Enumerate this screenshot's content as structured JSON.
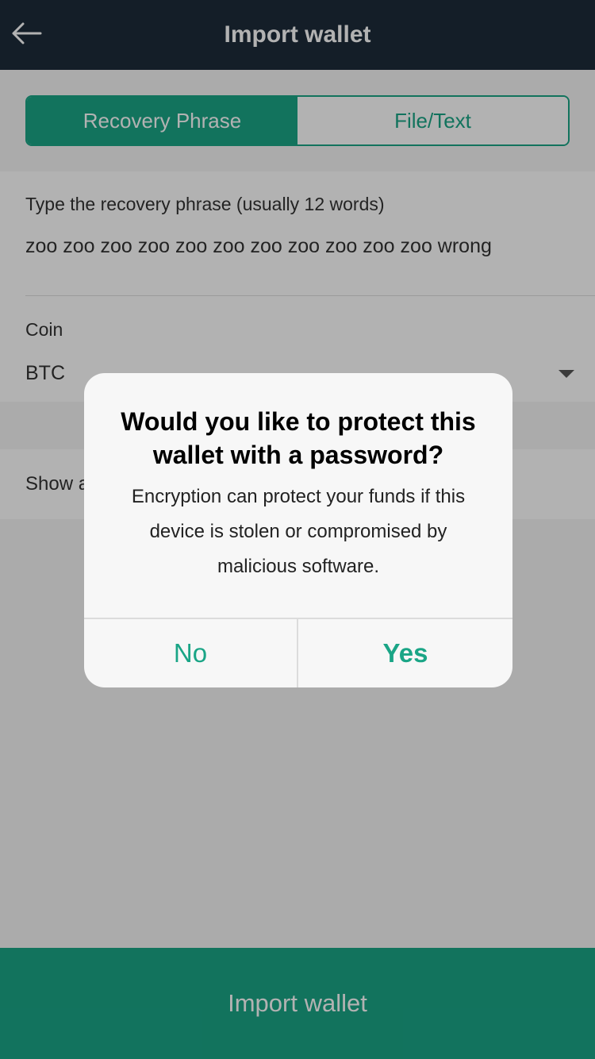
{
  "header": {
    "title": "Import wallet",
    "back_icon": "arrow-left-icon"
  },
  "tabs": [
    {
      "label": "Recovery Phrase",
      "active": true
    },
    {
      "label": "File/Text",
      "active": false
    }
  ],
  "form": {
    "phrase_label": "Type the recovery phrase (usually 12 words)",
    "phrase_value": "zoo zoo zoo zoo zoo zoo zoo zoo zoo zoo zoo wrong",
    "coin_label": "Coin",
    "coin_value": "BTC",
    "advanced_label": "Show a"
  },
  "footer": {
    "import_label": "Import wallet"
  },
  "dialog": {
    "title": "Would you like to protect this wallet with a password?",
    "message": "Encryption can protect your funds if this device is stolen or compromised by malicious software.",
    "no_label": "No",
    "yes_label": "Yes"
  },
  "colors": {
    "accent": "#1aa586",
    "header_bg": "#1e2c3a"
  }
}
